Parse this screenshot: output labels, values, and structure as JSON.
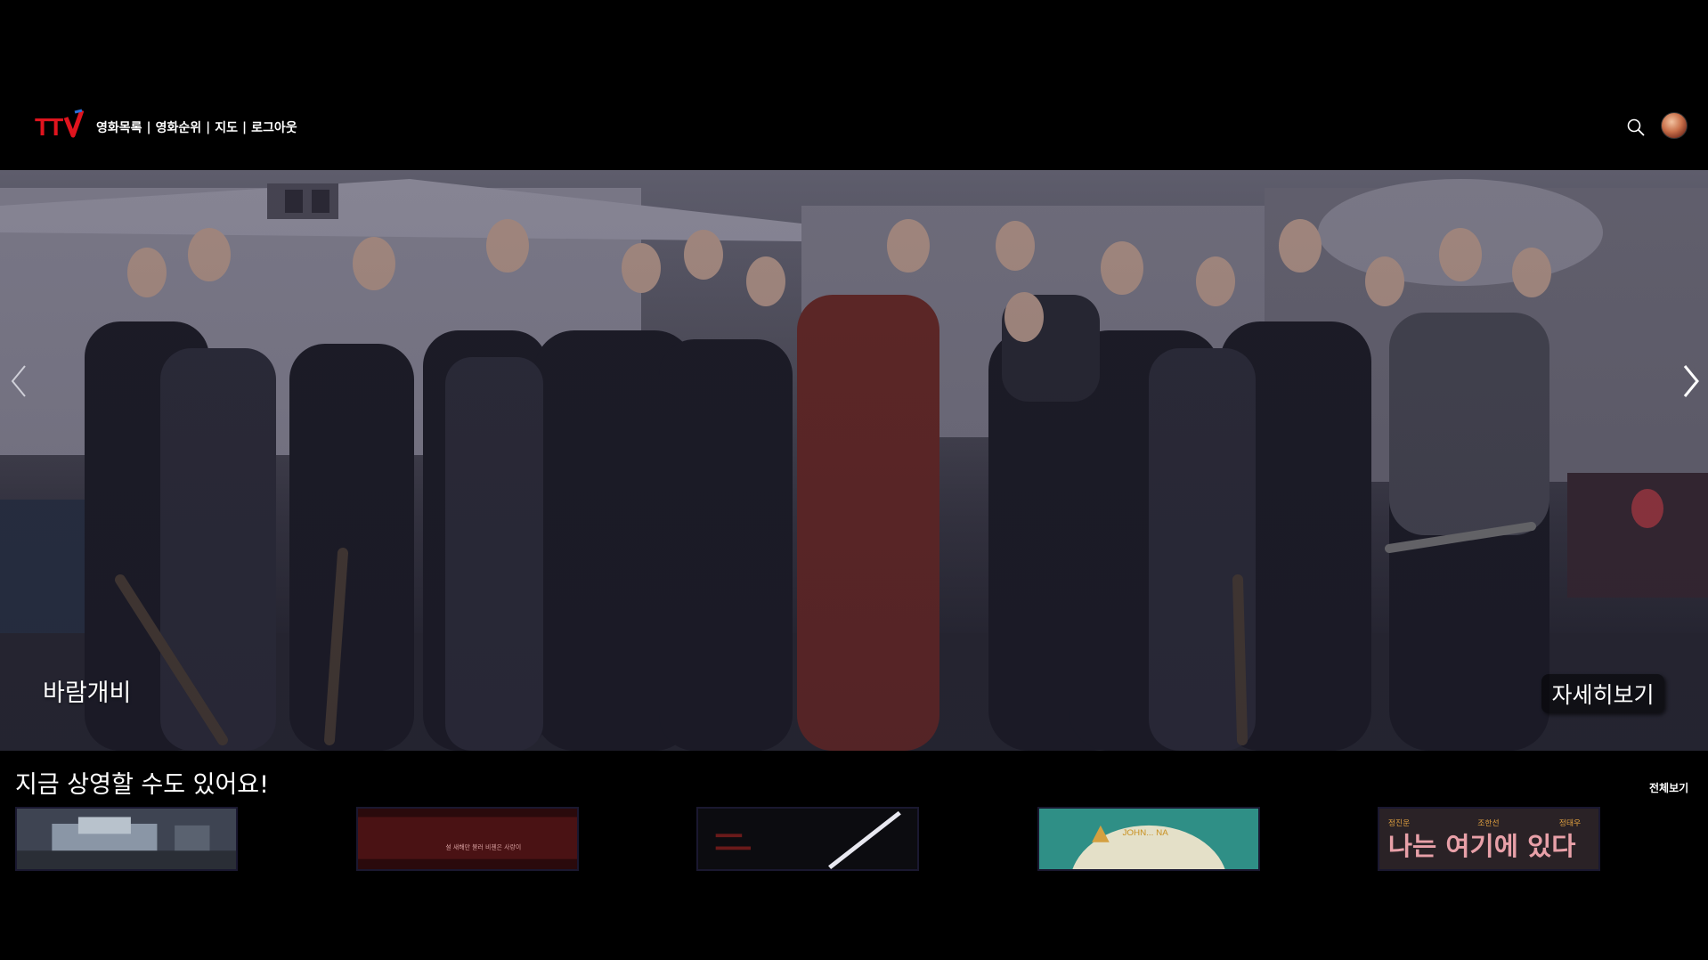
{
  "header": {
    "logo_text": "TTV",
    "nav": [
      {
        "label": "영화목록"
      },
      {
        "label": "영화순위"
      },
      {
        "label": "지도"
      },
      {
        "label": "로그아웃"
      }
    ],
    "separator": "|",
    "icons": {
      "search": "search-icon",
      "avatar": "avatar"
    }
  },
  "hero": {
    "title": "바람개비",
    "detail_label": "자세히보기",
    "icons": {
      "prev": "chevron-left-icon",
      "next": "chevron-right-icon"
    }
  },
  "section": {
    "title": "지금 상영할 수도 있어요!",
    "view_all": "전체보기",
    "cards": [
      {
        "poster_text": ""
      },
      {
        "poster_text": "설 새해만 불러 비첸은 사랑이"
      },
      {
        "poster_text": ""
      },
      {
        "poster_text": "JOHN... NA"
      },
      {
        "poster_text": "나는 여기에 있다",
        "credits": [
          "정진운",
          "조한선",
          "정태우"
        ]
      }
    ]
  },
  "colors": {
    "background": "#000000",
    "logo_red": "#e0141e",
    "logo_blue": "#2a6fd6"
  }
}
